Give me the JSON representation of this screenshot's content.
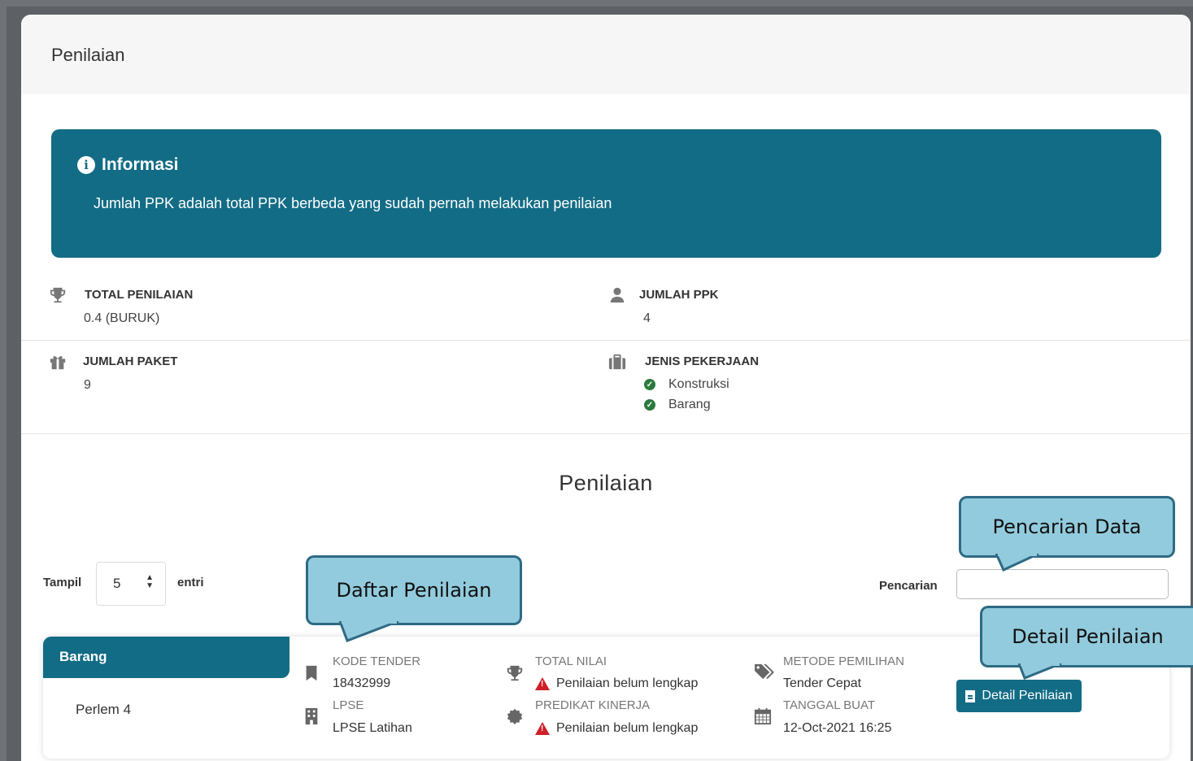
{
  "header": {
    "title": "Penilaian"
  },
  "info": {
    "title": "Informasi",
    "text": "Jumlah PPK adalah total PPK berbeda yang sudah pernah melakukan penilaian"
  },
  "stats": {
    "total_penilaian": {
      "label": "TOTAL PENILAIAN",
      "value": "0.4 (BURUK)",
      "icon": "trophy-icon"
    },
    "jumlah_ppk": {
      "label": "JUMLAH PPK",
      "value": "4",
      "icon": "user-icon"
    },
    "jumlah_paket": {
      "label": "JUMLAH PAKET",
      "value": "9",
      "icon": "gift-icon"
    },
    "jenis_pekerjaan": {
      "label": "JENIS PEKERJAAN",
      "items": [
        "Konstruksi",
        "Barang"
      ],
      "icon": "briefcase-icon"
    }
  },
  "section_title": "Penilaian",
  "length_control": {
    "prefix": "Tampil",
    "value": "5",
    "suffix": "entri"
  },
  "search": {
    "label": "Pencarian",
    "value": ""
  },
  "rows": [
    {
      "tag": "Barang",
      "name": "Perlem 4",
      "kode_tender_label": "KODE TENDER",
      "kode_tender": "18432999",
      "lpse_label": "LPSE",
      "lpse": "LPSE Latihan",
      "total_nilai_label": "TOTAL NILAI",
      "total_nilai": "Penilaian belum lengkap",
      "predikat_label": "PREDIKAT KINERJA",
      "predikat": "Penilaian belum lengkap",
      "metode_label": "METODE PEMILIHAN",
      "metode": "Tender Cepat",
      "tanggal_label": "TANGGAL BUAT",
      "tanggal": "12-Oct-2021 16:25",
      "button": "Detail Penilaian"
    }
  ],
  "callouts": {
    "pencarian": "Pencarian Data",
    "daftar": "Daftar Penilaian",
    "detail": "Detail Penilaian"
  },
  "colors": {
    "primary": "#136c85",
    "callout_fill": "#92cbdd",
    "callout_border": "#2e6a84",
    "warning": "#d0202a",
    "success": "#2b7a3d"
  }
}
